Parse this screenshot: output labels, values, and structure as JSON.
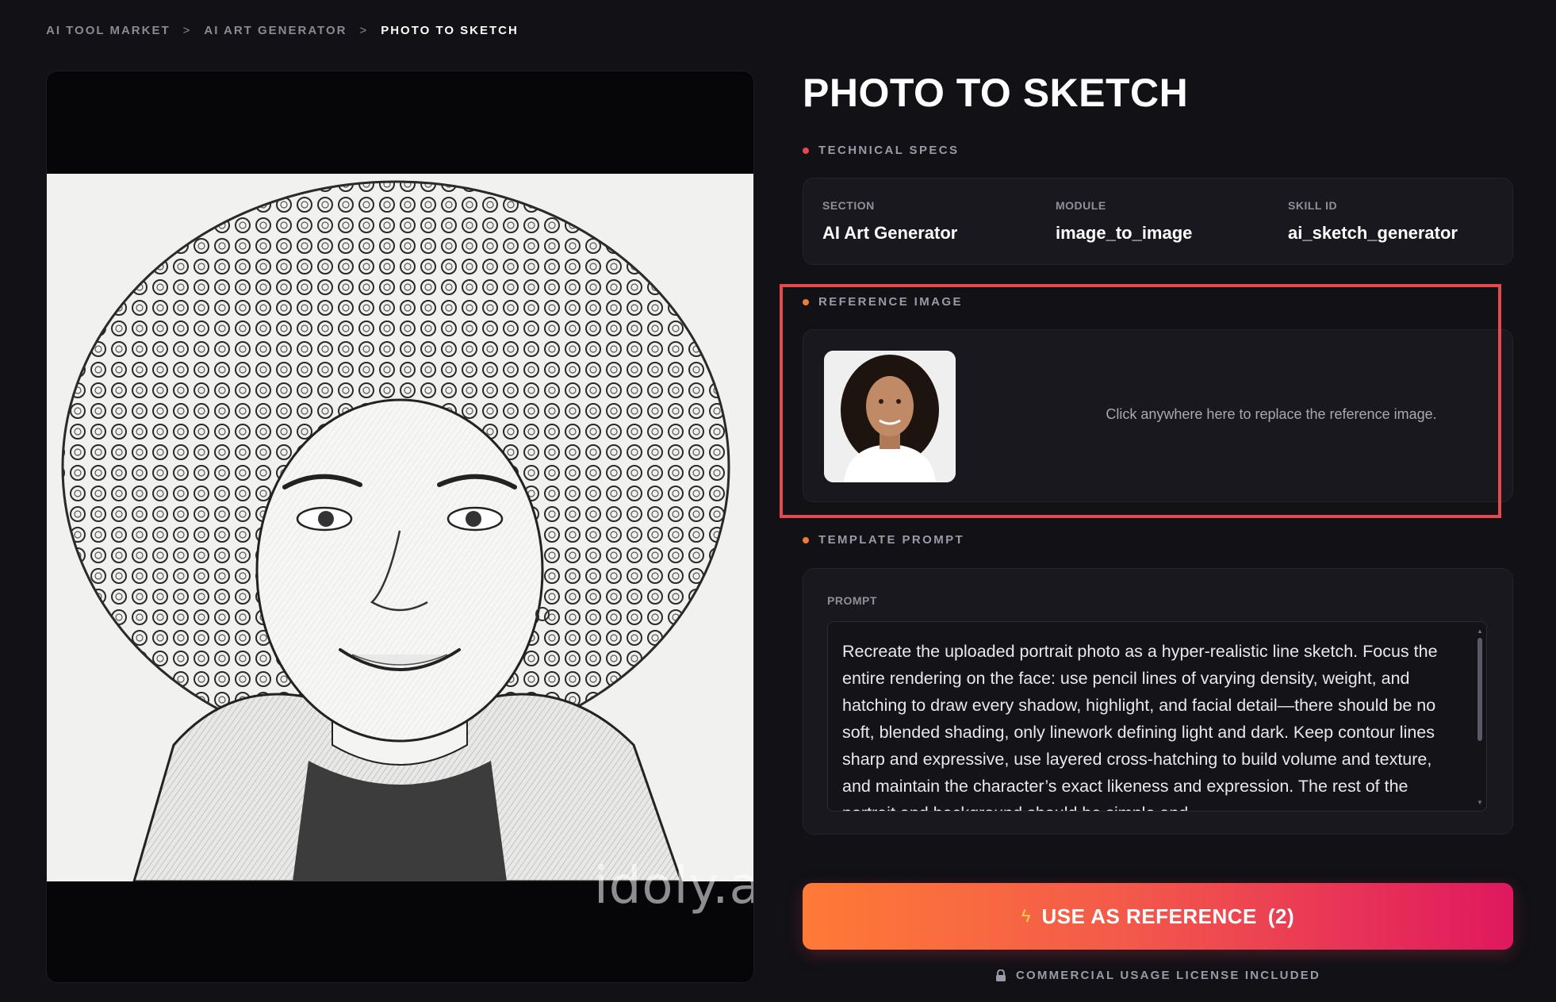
{
  "breadcrumb": {
    "items": [
      "AI TOOL MARKET",
      "AI ART GENERATOR",
      "PHOTO TO SKETCH"
    ],
    "separator": ">"
  },
  "preview": {
    "watermark": "idoly.ai"
  },
  "title": "PHOTO TO SKETCH",
  "technical_specs": {
    "label": "TECHNICAL SPECS",
    "dot_color": "#e5484d",
    "items": [
      {
        "key": "SECTION",
        "value": "AI Art Generator"
      },
      {
        "key": "MODULE",
        "value": "image_to_image"
      },
      {
        "key": "SKILL ID",
        "value": "ai_sketch_generator"
      }
    ]
  },
  "reference_image": {
    "label": "REFERENCE IMAGE",
    "dot_color": "#f07a3a",
    "hint": "Click anywhere here to replace the reference image."
  },
  "template_prompt": {
    "label": "TEMPLATE PROMPT",
    "dot_color": "#f07a3a",
    "field_label": "PROMPT",
    "text": "Recreate the uploaded portrait photo as a hyper-realistic line sketch. Focus the entire rendering on the face: use pencil lines of varying density, weight, and hatching to draw every shadow, highlight, and facial detail—there should be no soft, blended shading, only linework defining light and dark. Keep contour lines sharp and expressive, use layered cross-hatching to build volume and texture, and maintain the character’s exact likeness and expression. The rest of the portrait and background should be simple and"
  },
  "cta": {
    "icon": "bolt-icon",
    "label": "USE AS REFERENCE",
    "count": "(2)",
    "colors": [
      "#ff7a36",
      "#e0185f"
    ]
  },
  "license": {
    "icon": "lock-icon",
    "text": "COMMERCIAL USAGE LICENSE INCLUDED"
  },
  "highlight_color": "#e5484d"
}
